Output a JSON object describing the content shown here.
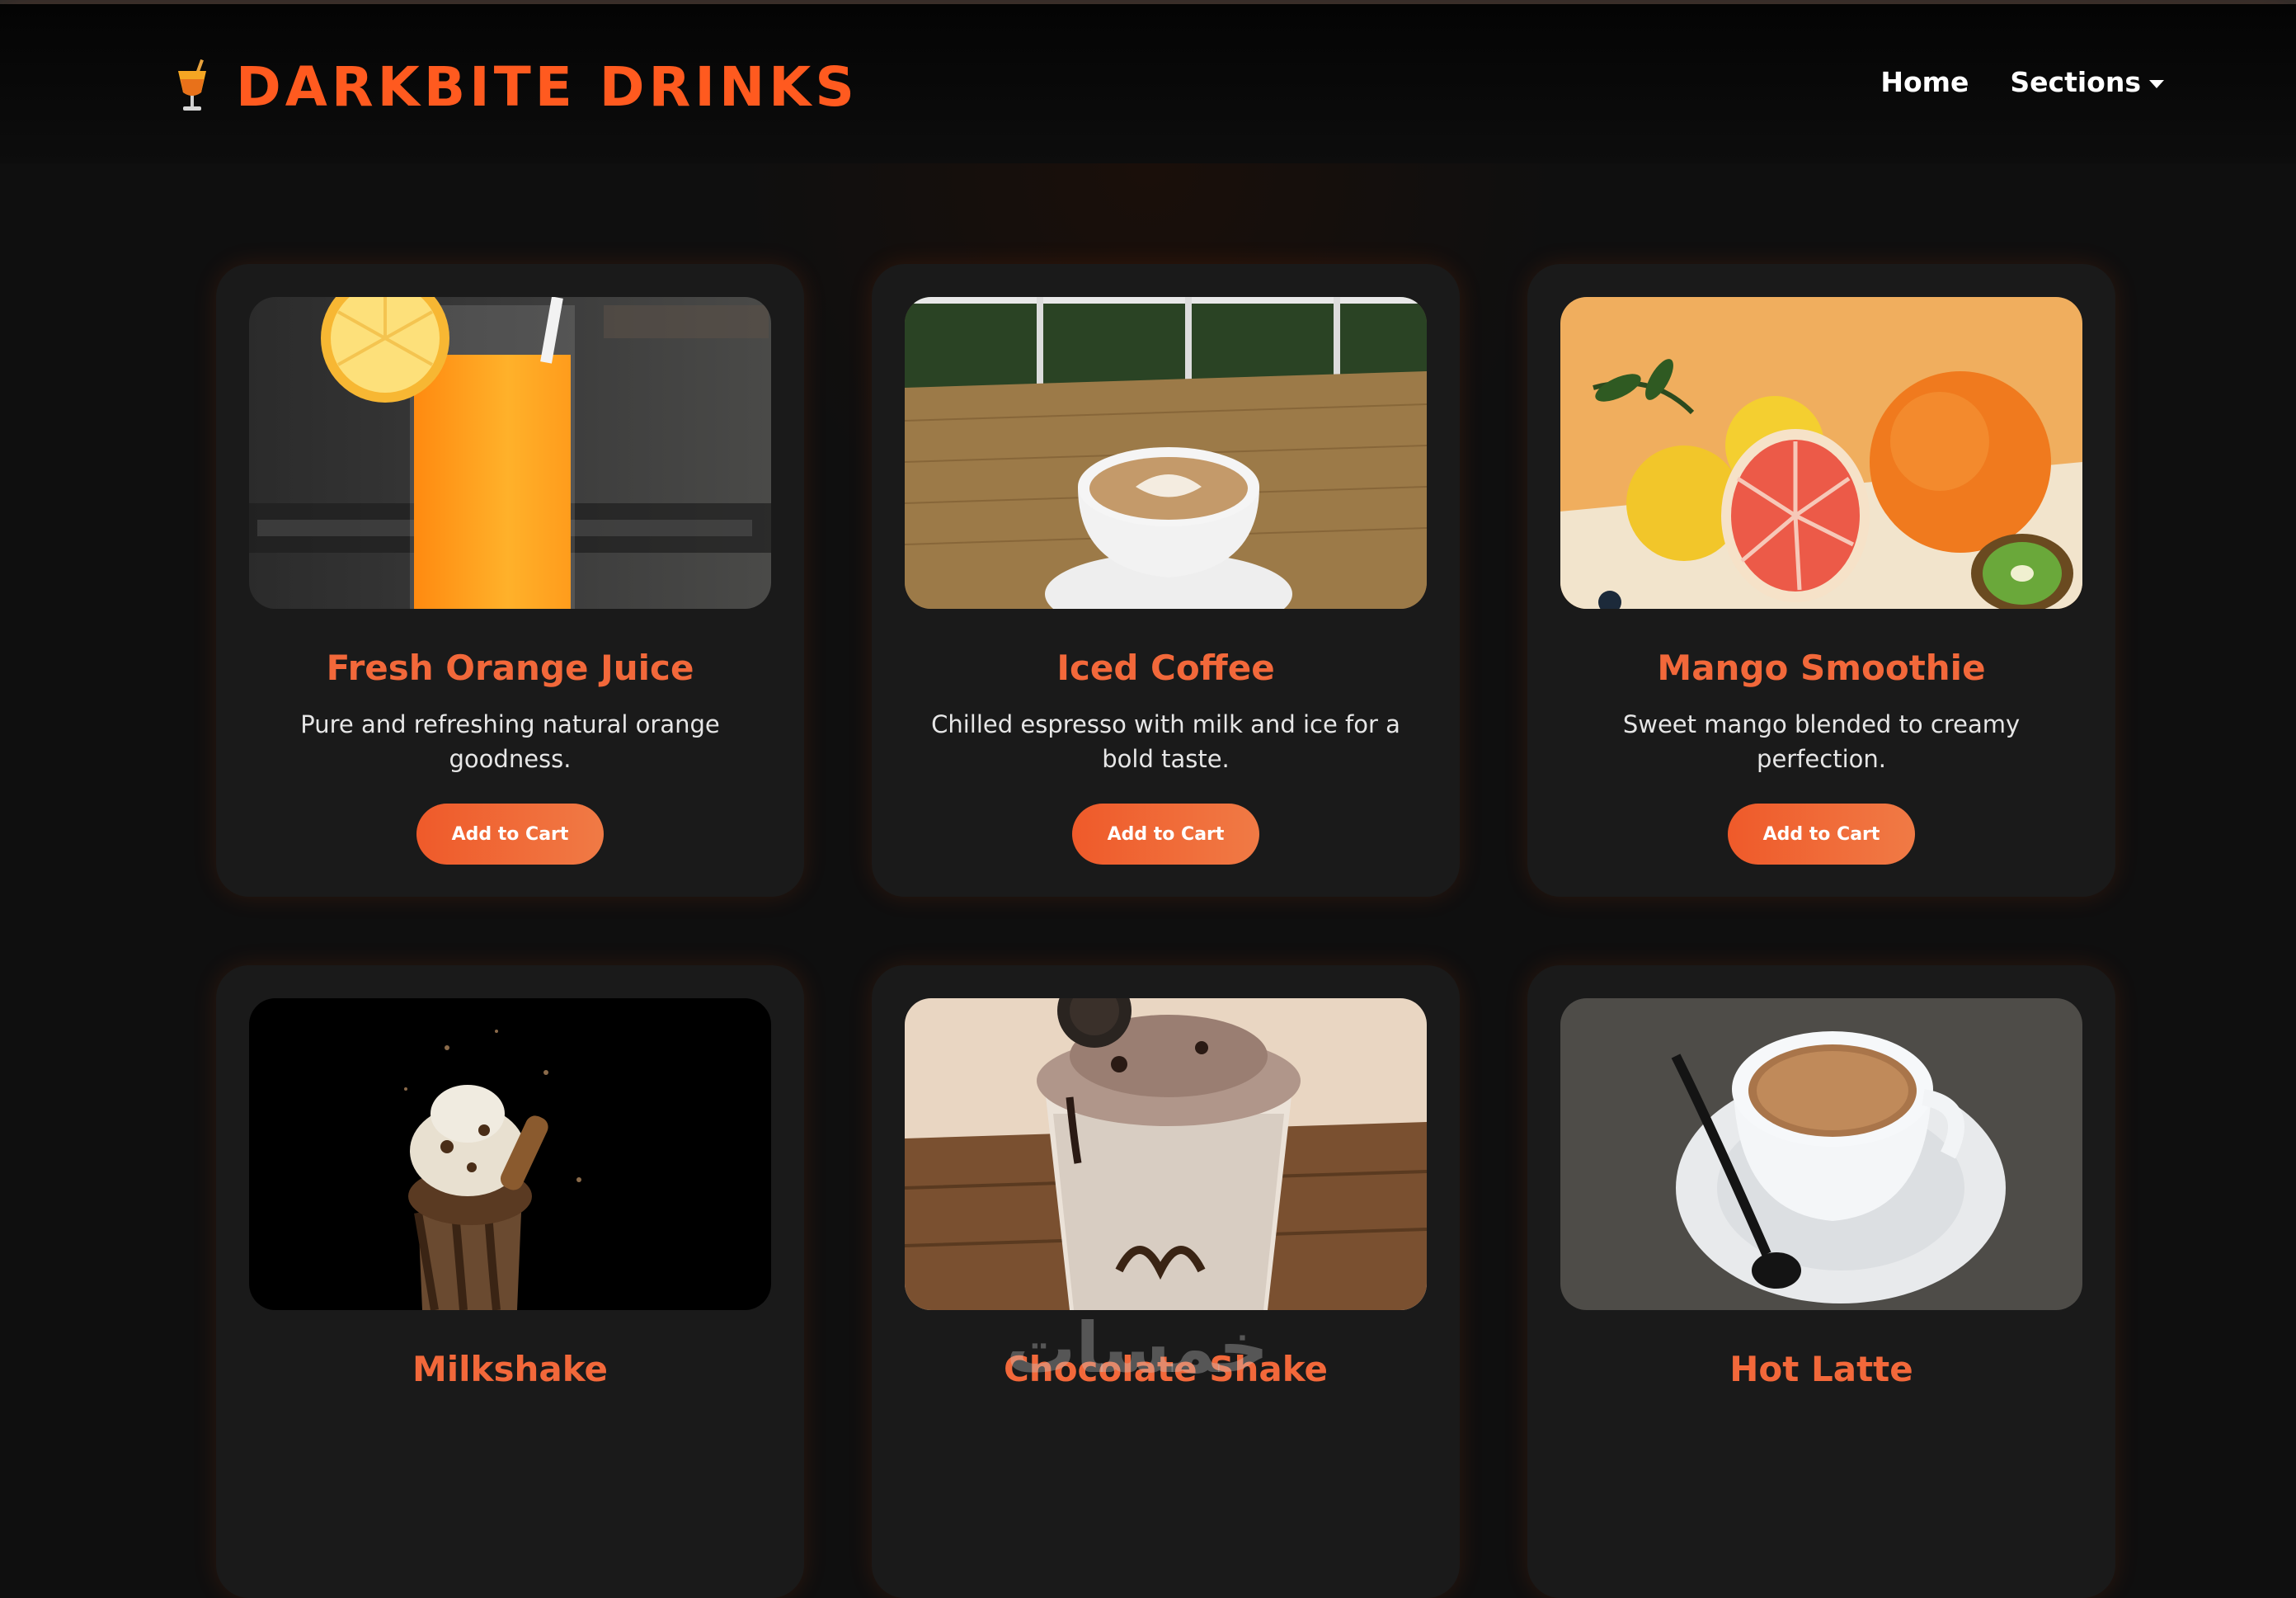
{
  "header": {
    "brand_name": "DARKBITE DRINKS",
    "logo_icon": "cocktail-glass-icon",
    "nav": {
      "home": "Home",
      "sections": "Sections"
    }
  },
  "products": [
    {
      "title": "Fresh Orange Juice",
      "description": "Pure and refreshing natural orange goodness.",
      "button": "Add to Cart",
      "image": "orange-juice-photo"
    },
    {
      "title": "Iced Coffee",
      "description": "Chilled espresso with milk and ice for a bold taste.",
      "button": "Add to Cart",
      "image": "latte-cup-photo"
    },
    {
      "title": "Mango Smoothie",
      "description": "Sweet mango blended to creamy perfection.",
      "button": "Add to Cart",
      "image": "citrus-fruits-photo"
    },
    {
      "title": "Milkshake",
      "image": "chocolate-milkshake-photo"
    },
    {
      "title": "Chocolate Shake",
      "image": "oreo-shake-photo"
    },
    {
      "title": "Hot Latte",
      "image": "espresso-cup-photo"
    }
  ],
  "watermark": "خمسات",
  "colors": {
    "accent": "#ff5a1f",
    "title": "#f2683a",
    "card_bg": "#1a1a1a",
    "page_bg": "#0f0f0f"
  }
}
